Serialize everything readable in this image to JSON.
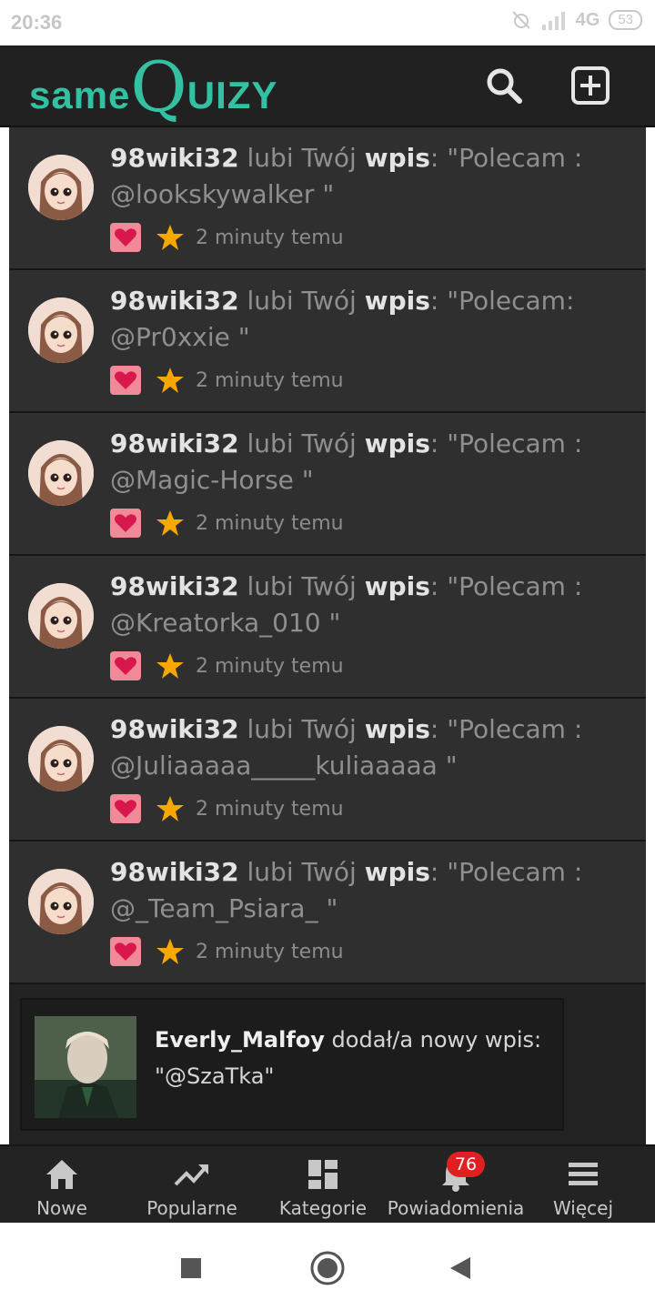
{
  "status_bar": {
    "time": "20:36",
    "network": "4G",
    "battery": "53"
  },
  "header": {
    "logo_same": "same",
    "logo_q": "Q",
    "logo_uizy": "UIZY"
  },
  "notifications": [
    {
      "user": "98wiki32",
      "action": "lubi Twój",
      "object": "wpis",
      "quote_start": ": \"Polecam :",
      "quote_rest": "@lookskywalker \"",
      "time": "2 minuty temu"
    },
    {
      "user": "98wiki32",
      "action": "lubi Twój",
      "object": "wpis",
      "quote_start": ": \"Polecam:",
      "quote_rest": "@Pr0xxie \"",
      "time": "2 minuty temu"
    },
    {
      "user": "98wiki32",
      "action": "lubi Twój",
      "object": "wpis",
      "quote_start": ": \"Polecam :",
      "quote_rest": "@Magic-Horse \"",
      "time": "2 minuty temu"
    },
    {
      "user": "98wiki32",
      "action": "lubi Twój",
      "object": "wpis",
      "quote_start": ": \"Polecam :",
      "quote_rest": "@Kreatorka_010 \"",
      "time": "2 minuty temu"
    },
    {
      "user": "98wiki32",
      "action": "lubi Twój",
      "object": "wpis",
      "quote_start": ": \"Polecam :",
      "quote_rest": "@Juliaaaaa_____kuliaaaaa \"",
      "time": "2 minuty temu"
    },
    {
      "user": "98wiki32",
      "action": "lubi Twój",
      "object": "wpis",
      "quote_start": ": \"Polecam :",
      "quote_rest": "@_Team_Psiara_ \"",
      "time": "2 minuty temu"
    }
  ],
  "post_card": {
    "user": "Everly_Malfoy",
    "action": "dodał/a nowy wpis:",
    "quote": "\"@SzaTka\""
  },
  "bottom_nav": {
    "items": [
      {
        "label": "Nowe",
        "icon": "home-icon"
      },
      {
        "label": "Popularne",
        "icon": "trending-icon"
      },
      {
        "label": "Kategorie",
        "icon": "dashboard-icon"
      },
      {
        "label": "Powiadomienia",
        "icon": "bell-icon",
        "badge": "76"
      },
      {
        "label": "Więcej",
        "icon": "menu-icon"
      }
    ]
  },
  "colors": {
    "brand": "#34c1a3",
    "badge": "#e02020",
    "heart": "#f08a98",
    "star": "#f6a800"
  }
}
